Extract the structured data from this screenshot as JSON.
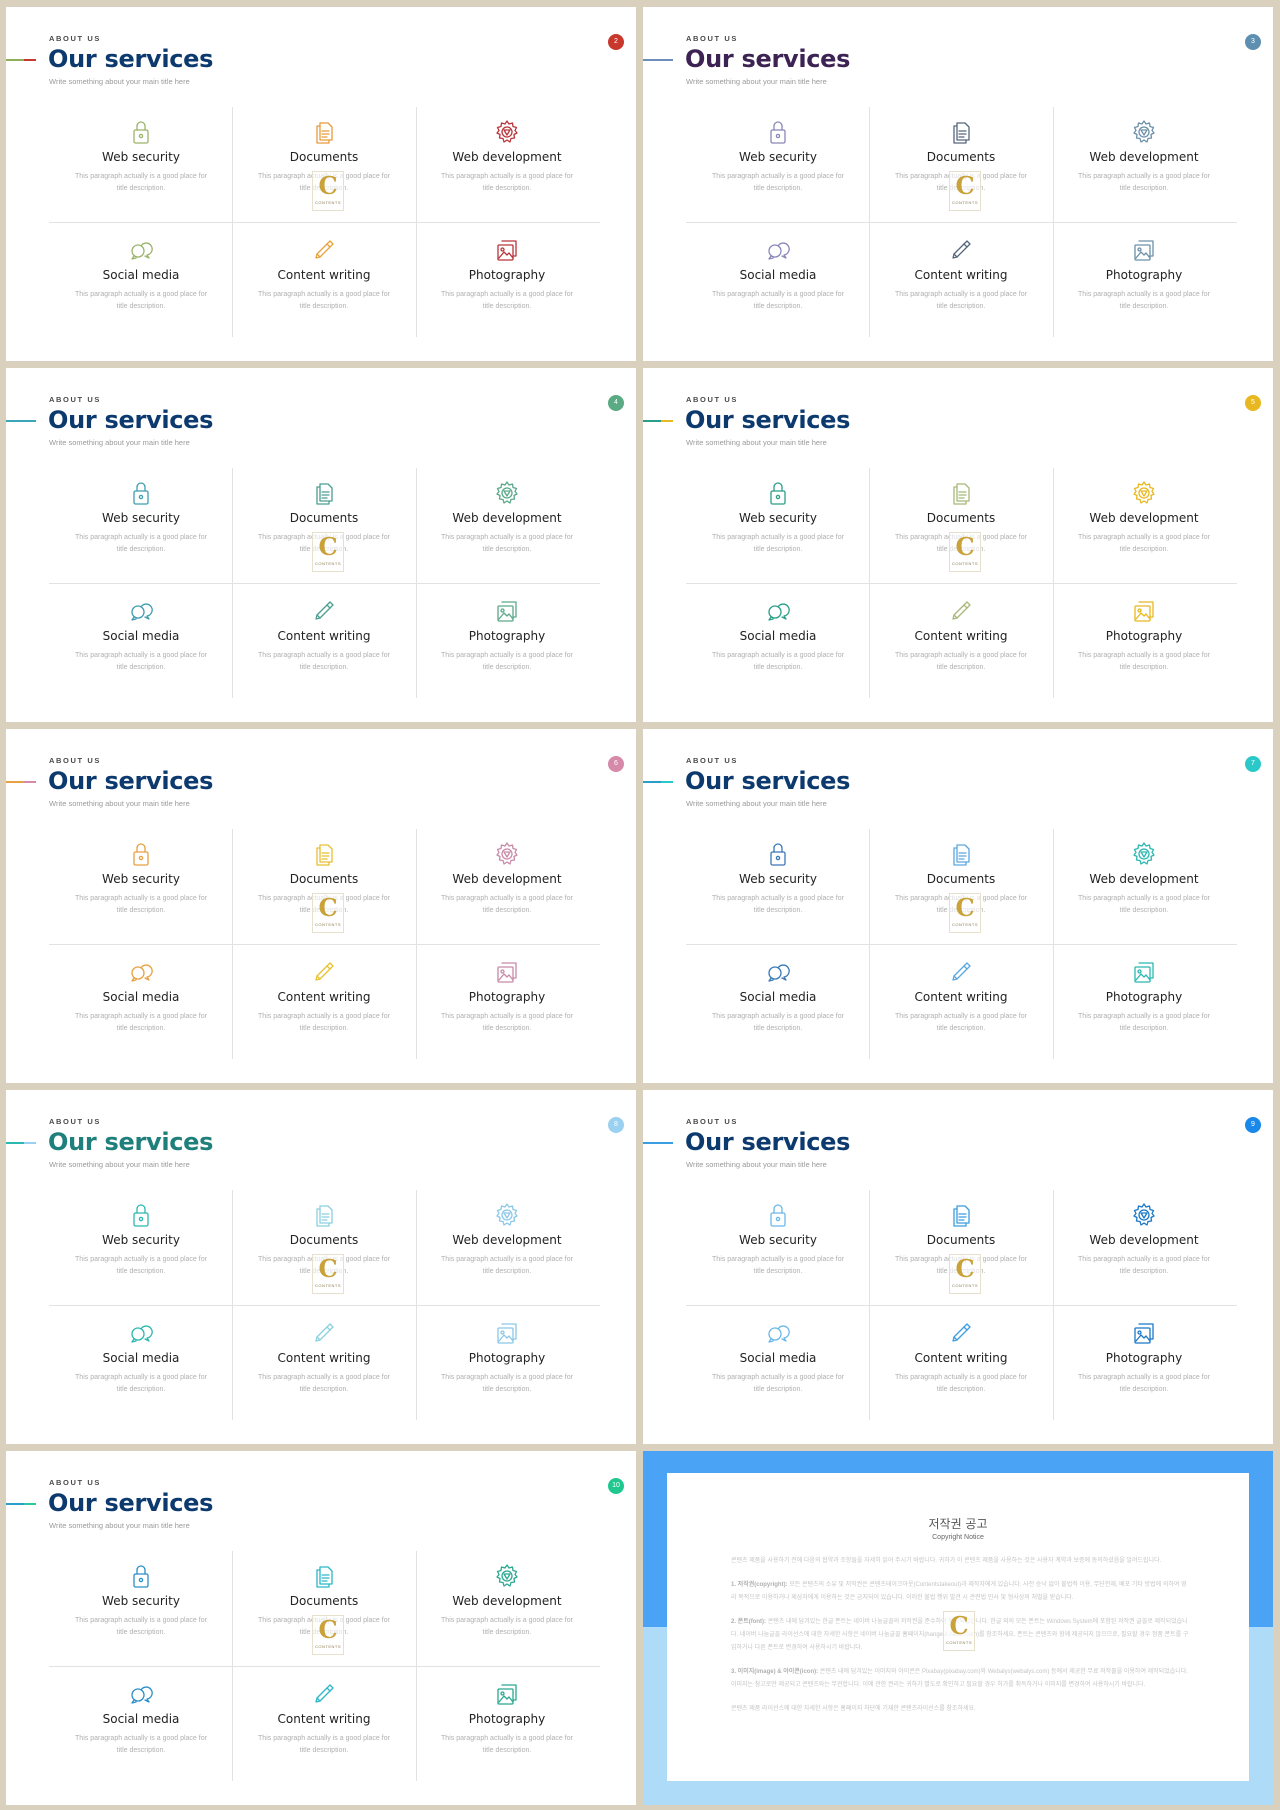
{
  "service_slides": [
    {
      "number": "2",
      "eyebrow": "ABOUT US",
      "title": "Our services",
      "subtitle": "Write something about your main title here",
      "title_color": "#0d3a6e",
      "badge_color": "#c8382c",
      "accent_colors": [
        "#8fae5a",
        "#c8382c"
      ],
      "icon_colors": [
        "#9bb36a",
        "#e89a3c",
        "#b9343a",
        "#9bb36a",
        "#e8a23c",
        "#b9343a"
      ]
    },
    {
      "number": "3",
      "eyebrow": "ABOUT US",
      "title": "Our services",
      "subtitle": "Write something about your main title here",
      "title_color": "#3d2354",
      "badge_color": "#5e8fb0",
      "accent_colors": [
        "#6b8fb8",
        "#6b8fb8"
      ],
      "icon_colors": [
        "#8a86b8",
        "#56667e",
        "#6c90a8",
        "#8a86b8",
        "#56667e",
        "#6c90a8"
      ]
    },
    {
      "number": "4",
      "eyebrow": "ABOUT US",
      "title": "Our services",
      "subtitle": "Write something about your main title here",
      "title_color": "#0d3a6e",
      "badge_color": "#5aaa84",
      "accent_colors": [
        "#3aa6b8",
        "#3aa6b8"
      ],
      "icon_colors": [
        "#3d9eb0",
        "#4a9e90",
        "#5aa88a",
        "#3d9eb0",
        "#4a9e90",
        "#5aa88a"
      ]
    },
    {
      "number": "5",
      "eyebrow": "ABOUT US",
      "title": "Our services",
      "subtitle": "Write something about your main title here",
      "title_color": "#0d3a6e",
      "badge_color": "#e8b820",
      "accent_colors": [
        "#2a9e88",
        "#e8b820"
      ],
      "icon_colors": [
        "#2a9e88",
        "#a8b878",
        "#e8b820",
        "#2a9e88",
        "#a8b878",
        "#e8b820"
      ]
    },
    {
      "number": "6",
      "eyebrow": "ABOUT US",
      "title": "Our services",
      "subtitle": "Write something about your main title here",
      "title_color": "#0d3a6e",
      "badge_color": "#d48aa8",
      "accent_colors": [
        "#e8a040",
        "#d48aa8"
      ],
      "icon_colors": [
        "#e8a040",
        "#e8c030",
        "#c88aa8",
        "#e8a040",
        "#e8c030",
        "#c88aa8"
      ]
    },
    {
      "number": "7",
      "eyebrow": "ABOUT US",
      "title": "Our services",
      "subtitle": "Write something about your main title here",
      "title_color": "#0d3a6e",
      "badge_color": "#2ac8c8",
      "accent_colors": [
        "#2a9ec8",
        "#2ac8c8"
      ],
      "icon_colors": [
        "#3a78b8",
        "#5aa8e0",
        "#2ab8b0",
        "#3a78b8",
        "#5aa8e0",
        "#2ab8b0"
      ]
    },
    {
      "number": "8",
      "eyebrow": "ABOUT US",
      "title": "Our services",
      "subtitle": "Write something about your main title here",
      "title_color": "#1f7f7a",
      "badge_color": "#9ad0f0",
      "accent_colors": [
        "#2ab8b0",
        "#9ad0f0"
      ],
      "icon_colors": [
        "#2ab8b0",
        "#8ad0e0",
        "#8ac8e8",
        "#2ab8b0",
        "#8ad0e0",
        "#8ac8e8"
      ]
    },
    {
      "number": "9",
      "eyebrow": "ABOUT US",
      "title": "Our services",
      "subtitle": "Write something about your main title here",
      "title_color": "#0d3a6e",
      "badge_color": "#1a88e8",
      "accent_colors": [
        "#3a9ee0",
        "#3a9ee0"
      ],
      "icon_colors": [
        "#6ab8e8",
        "#3a9ee0",
        "#1a78c8",
        "#6ab8e8",
        "#3a9ee0",
        "#1a78c8"
      ]
    },
    {
      "number": "10",
      "eyebrow": "ABOUT US",
      "title": "Our services",
      "subtitle": "Write something about your main title here",
      "title_color": "#0d3a6e",
      "badge_color": "#20c890",
      "accent_colors": [
        "#2a9ec8",
        "#2ac8a0"
      ],
      "icon_colors": [
        "#2a8ec8",
        "#2ab8c8",
        "#2aa890",
        "#2a8ec8",
        "#2ab8c8",
        "#2aa890"
      ]
    }
  ],
  "services": [
    {
      "name": "Web security",
      "icon": "lock-icon",
      "description": "This paragraph actually is a good place for title description."
    },
    {
      "name": "Documents",
      "icon": "documents-icon",
      "description": "This paragraph actually is a good place for title description."
    },
    {
      "name": "Web development",
      "icon": "gear-icon",
      "description": "This paragraph actually is a good place for title description."
    },
    {
      "name": "Social media",
      "icon": "chat-bubbles-icon",
      "description": "This paragraph actually is a good place for title description."
    },
    {
      "name": "Content writing",
      "icon": "pencil-icon",
      "description": "This paragraph actually is a good place for title description."
    },
    {
      "name": "Photography",
      "icon": "images-icon",
      "description": "This paragraph actually is a good place for title description."
    }
  ],
  "watermark": {
    "letter": "C",
    "text": "CONTENTS"
  },
  "copyright": {
    "title": "저작권 공고",
    "subtitle": "Copyright Notice",
    "intro": "콘텐츠 제품을 사용하기 전에 다음의 협약과 조항들을 자세히 읽어 주시기 바랍니다. 귀하가 이 콘텐츠 제품을 사용하는 것은 사용자 계약과 보증에 동의하셨음을 알려드립니다.",
    "sections": [
      {
        "heading": "1. 저작권(copyright):",
        "text": "모든 콘텐츠의 소유 및 저작권은 콘텐츠테이크아웃(Contentstakeout)과 제작자에게 있습니다. 사전 승낙 없이 불법적 이용, 무단전재, 배포 기타 방법에 의하여 영리 목적으로 이용하거나 제삼자에게 이용하는 것은 금지되어 있습니다. 이러한 불법 행위 발견 시 관련법 민사 및 형사상의 처벌을 받습니다."
      },
      {
        "heading": "2. 폰트(font):",
        "text": "콘텐츠 내에 담겨있는 한글 폰트는 네이버 나눔글꼴의 저작권을 준수하여 제작되었습니다. 한글 외의 모든 폰트는 Windows System에 포함된 저작권 글꼴로 제작되었습니다. 네이버 나눔글꼴 라이선스에 대한 자세한 사항은 네이버 나눔글꼴 홈페이지(hangeul.naver.com)를 참조하세요. 폰트는 콘텐츠와 함께 제공되지 않으므로, 필요할 경우 정품 폰트를 구입하거나 다른 폰트로 변경하여 사용하시기 바랍니다."
      },
      {
        "heading": "3. 이미지(image) & 아이콘(icon):",
        "text": "콘텐츠 내에 담겨있는 이미지와 아이콘은 Pixabay(pixabay.com)와 Webalys(webalys.com) 등에서 제공한 무료 저작물을 이용하여 제작되었습니다. 이미지는 참고로만 제공되고 콘텐츠와는 무관합니다. 이에 관한 권리는 귀하가 별도로 확인하고 필요할 경우 허가를 취득하거나 이미지를 변경하여 사용하시기 바랍니다."
      }
    ],
    "footer": "콘텐츠 제품 라이선스에 대한 자세한 사항은 홈페이지 하단에 기재한 콘텐츠라이선스를 참조하세요."
  }
}
